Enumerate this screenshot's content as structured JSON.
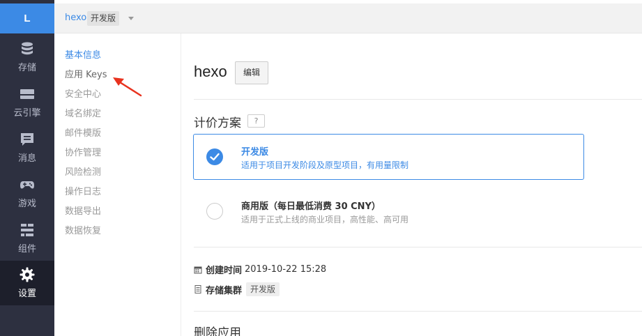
{
  "logo": {
    "letter": "L"
  },
  "rail": {
    "items": [
      {
        "label": "存储",
        "icon": "database-icon"
      },
      {
        "label": "云引擎",
        "icon": "server-icon"
      },
      {
        "label": "消息",
        "icon": "message-icon"
      },
      {
        "label": "游戏",
        "icon": "gamepad-icon"
      },
      {
        "label": "组件",
        "icon": "components-icon"
      },
      {
        "label": "设置",
        "icon": "gear-icon",
        "active": true
      }
    ]
  },
  "topbar": {
    "app_name": "hexo",
    "app_tag": "开发版"
  },
  "subnav": {
    "items": [
      {
        "label": "基本信息",
        "active": true
      },
      {
        "label": "应用 Keys"
      },
      {
        "label": "安全中心"
      },
      {
        "label": "域名绑定"
      },
      {
        "label": "邮件模版"
      },
      {
        "label": "协作管理"
      },
      {
        "label": "风险检测"
      },
      {
        "label": "操作日志"
      },
      {
        "label": "数据导出"
      },
      {
        "label": "数据恢复"
      }
    ]
  },
  "main": {
    "title": "hexo",
    "edit_label": "编辑",
    "pricing": {
      "title": "计价方案",
      "help": "?",
      "plans": [
        {
          "name": "开发版",
          "desc": "适用于项目开发阶段及原型项目，有用量限制",
          "selected": true
        },
        {
          "name": "商用版（每日最低消费 30 CNY）",
          "desc": "适用于正式上线的商业项目，高性能、高可用",
          "selected": false
        }
      ]
    },
    "created": {
      "label": "创建时间",
      "value": "2019-10-22 15:28"
    },
    "cluster": {
      "label": "存储集群",
      "value": "开发版"
    },
    "delete_title": "删除应用"
  },
  "colors": {
    "accent": "#3c8ae5",
    "rail_bg": "#2d3040",
    "rail_active": "#1d1f2b",
    "annotation_arrow": "#e8321e"
  }
}
